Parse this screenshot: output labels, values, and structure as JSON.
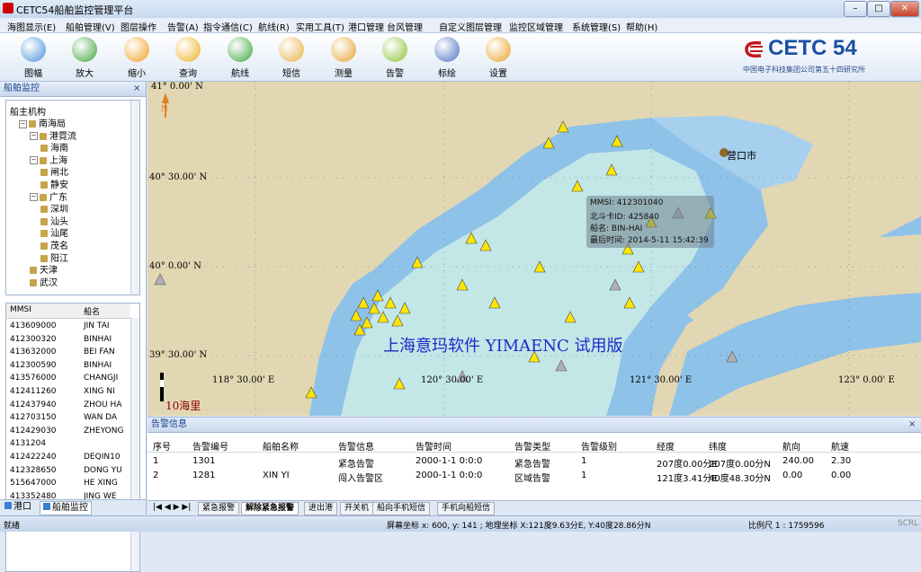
{
  "window": {
    "title": "CETC54船舶监控管理平台",
    "min": "–",
    "max": "□",
    "close": "✕"
  },
  "menu": [
    "海图显示(E)",
    "船舶管理(V)",
    "图层操作",
    "告警(A)",
    "指令通信(C)",
    "航线(R)",
    "实用工具(T)",
    "港口管理",
    "台风管理",
    "自定义图层管理",
    "监控区域管理",
    "系统管理(S)",
    "帮助(H)"
  ],
  "toolbar": [
    {
      "label": "图幅",
      "icon": "map-sheet-icon",
      "color": "#4a90d9"
    },
    {
      "label": "放大",
      "icon": "zoom-in-icon",
      "color": "#3aa53a"
    },
    {
      "label": "缩小",
      "icon": "zoom-out-icon",
      "color": "#f0a020"
    },
    {
      "label": "查询",
      "icon": "search-icon",
      "color": "#f0b020"
    },
    {
      "label": "航线",
      "icon": "route-icon",
      "color": "#3aa53a"
    },
    {
      "label": "短信",
      "icon": "message-icon",
      "color": "#e8b040"
    },
    {
      "label": "测量",
      "icon": "measure-icon",
      "color": "#e8a030"
    },
    {
      "label": "告警",
      "icon": "alert-icon",
      "color": "#8ac230"
    },
    {
      "label": "标绘",
      "icon": "plot-icon",
      "color": "#4a70c0"
    },
    {
      "label": "设置",
      "icon": "settings-gear-icon",
      "color": "#e8a020"
    }
  ],
  "logo": {
    "text": "CETC 54",
    "subtitle": "中国电子科技集团公司第五十四研究所"
  },
  "left_panel": {
    "title": "船舶监控",
    "tree_root": "船主机构",
    "tree": [
      {
        "label": "南海局",
        "level": 1,
        "box": "−"
      },
      {
        "label": "港霓流",
        "level": 2,
        "box": "−"
      },
      {
        "label": "海南",
        "level": 3,
        "box": ""
      },
      {
        "label": "上海",
        "level": 2,
        "box": "−"
      },
      {
        "label": "闸北",
        "level": 3,
        "box": ""
      },
      {
        "label": "静安",
        "level": 3,
        "box": ""
      },
      {
        "label": "广东",
        "level": 2,
        "box": "−"
      },
      {
        "label": "深圳",
        "level": 3,
        "box": ""
      },
      {
        "label": "汕头",
        "level": 3,
        "box": ""
      },
      {
        "label": "汕尾",
        "level": 3,
        "box": ""
      },
      {
        "label": "茂名",
        "level": 3,
        "box": ""
      },
      {
        "label": "阳江",
        "level": 3,
        "box": ""
      },
      {
        "label": "天津",
        "level": 2,
        "box": ""
      },
      {
        "label": "武汉",
        "level": 2,
        "box": ""
      }
    ],
    "ship_list_headers": [
      "MMSI",
      "船名"
    ],
    "ships": [
      [
        "413609000",
        "JIN TAI"
      ],
      [
        "412300320",
        "BINHAI"
      ],
      [
        "413632000",
        "BEI FAN"
      ],
      [
        "412300590",
        "BINHAI"
      ],
      [
        "413576000",
        "CHANGJI"
      ],
      [
        "412411260",
        "XING NI"
      ],
      [
        "412437940",
        "ZHOU HA"
      ],
      [
        "412703150",
        "WAN DA"
      ],
      [
        "412429030",
        "ZHEYONG"
      ],
      [
        "4131204",
        ""
      ],
      [
        "412422240",
        "DEQIN10"
      ],
      [
        "412328650",
        "DONG YU"
      ],
      [
        "515647000",
        "HE XING"
      ],
      [
        "413352480",
        "JING WE"
      ]
    ],
    "tabs": [
      "港口",
      "船舶监控"
    ]
  },
  "map": {
    "north": "N",
    "coords": {
      "lat1": "41° 0.00' N",
      "lat2": "40° 30.00' N",
      "lat3": "40° 0.00' N",
      "lat4": "39° 30.00' N",
      "lon1": "118° 30.00' E",
      "lon2": "120° 30.00' E",
      "lon3": "121° 30.00' E",
      "lon4": "123° 0.00' E"
    },
    "city": "营口市",
    "watermark": "上海意玛软件 YIMAENC 试用版",
    "scale_label": "10海里",
    "infobox": {
      "mmsi": "MMSI: 412301040",
      "beidou": "北斗卡ID: 425840",
      "name": "船名: BIN-HAI",
      "time": "最后时间: 2014-5-11 15:42:39"
    }
  },
  "alert_panel": {
    "title": "告警信息",
    "headers": [
      "序号",
      "告警编号",
      "船舶名称",
      "告警信息",
      "告警时间",
      "告警类型",
      "告警级别",
      "经度",
      "纬度",
      "航向",
      "航速"
    ],
    "rows": [
      [
        "1",
        "1301",
        "",
        "紧急告警",
        "2000-1-1 0:0:0",
        "紧急告警",
        "1",
        "207度0.00分E",
        "207度0.00分N",
        "240.00",
        "2.30"
      ],
      [
        "2",
        "1281",
        "XIN YI",
        "闯入告警区",
        "2000-1-1 0:0:0",
        "区域告警",
        "1",
        "121度3.41分E",
        "40度48.30分N",
        "0.00",
        "0.00"
      ]
    ],
    "tabs": [
      "紧急报警",
      "解除紧急报警",
      "进出港",
      "开关机",
      "船向手机短信",
      "手机向船短信"
    ]
  },
  "status": {
    "left": "就绪",
    "coords": "屏幕坐标 x: 600, y: 141 ; 地理坐标 X:121度9.63分E, Y:40度28.86分N",
    "scale": "比例尺 1 : 1759596",
    "scrl": "SCRL"
  }
}
